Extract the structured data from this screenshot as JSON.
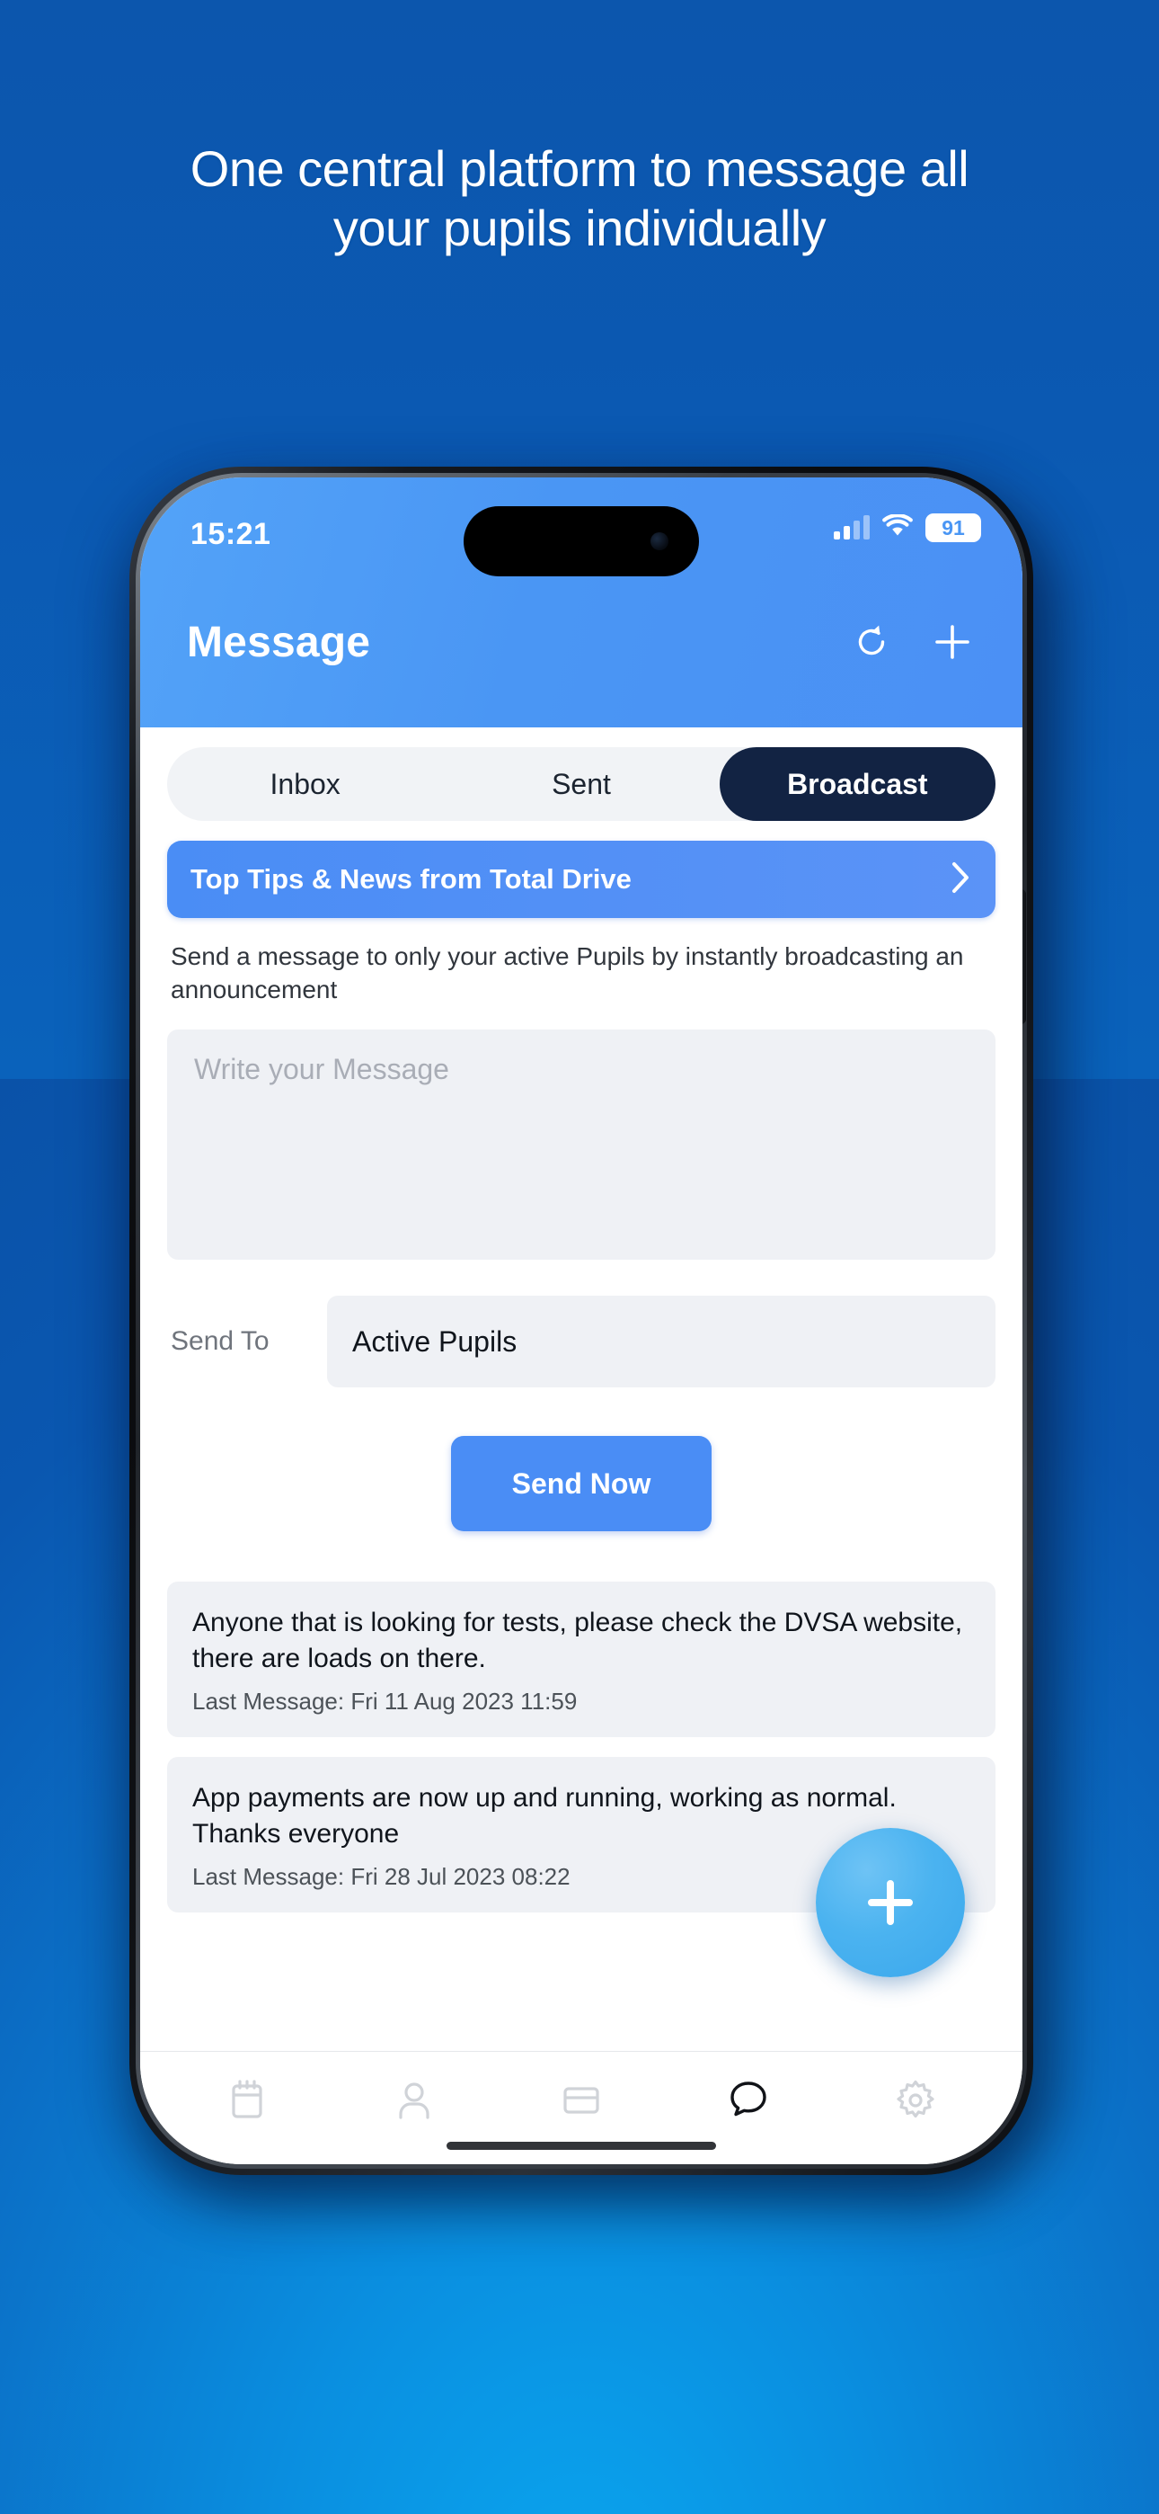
{
  "marketing": {
    "headline_line1": "One central platform to message all",
    "headline_line2": "your pupils individually",
    "background_color": "#0a5bb4"
  },
  "statusbar": {
    "time": "15:21",
    "battery": "91",
    "signal_icon": "cellular-bars-icon",
    "wifi_icon": "wifi-icon",
    "battery_icon": "battery-icon"
  },
  "header": {
    "title": "Message",
    "refresh_icon": "refresh-icon",
    "add_icon": "plus-icon",
    "accent_color": "#4a96f4"
  },
  "tabs": {
    "items": [
      {
        "label": "Inbox",
        "active": false
      },
      {
        "label": "Sent",
        "active": false
      },
      {
        "label": "Broadcast",
        "active": true
      }
    ],
    "active_bg": "#122343"
  },
  "banner": {
    "text": "Top Tips & News from Total Drive",
    "chevron_icon": "chevron-right-icon",
    "color": "#4a8df5"
  },
  "description": "Send a message to only your active Pupils by instantly broadcasting an announcement",
  "compose": {
    "placeholder": "Write your Message",
    "value": ""
  },
  "send_to": {
    "label": "Send To",
    "value": "Active Pupils",
    "options": [
      "Active Pupils"
    ]
  },
  "send_button": {
    "label": "Send Now",
    "color": "#4a8df5"
  },
  "broadcast_history": [
    {
      "text": "Anyone that is looking for tests, please check the DVSA website, there are loads on there.",
      "meta": "Last Message: Fri 11 Aug 2023 11:59"
    },
    {
      "text": "App payments are now up and running, working as normal. Thanks everyone",
      "meta": "Last Message: Fri 28 Jul 2023 08:22"
    }
  ],
  "fab": {
    "icon": "plus-icon",
    "color": "#4bb3f0"
  },
  "bottom_nav": {
    "items": [
      {
        "icon": "calendar-icon",
        "active": false
      },
      {
        "icon": "person-icon",
        "active": false
      },
      {
        "icon": "card-icon",
        "active": false
      },
      {
        "icon": "chat-bubble-icon",
        "active": true
      },
      {
        "icon": "gear-icon",
        "active": false
      }
    ]
  }
}
